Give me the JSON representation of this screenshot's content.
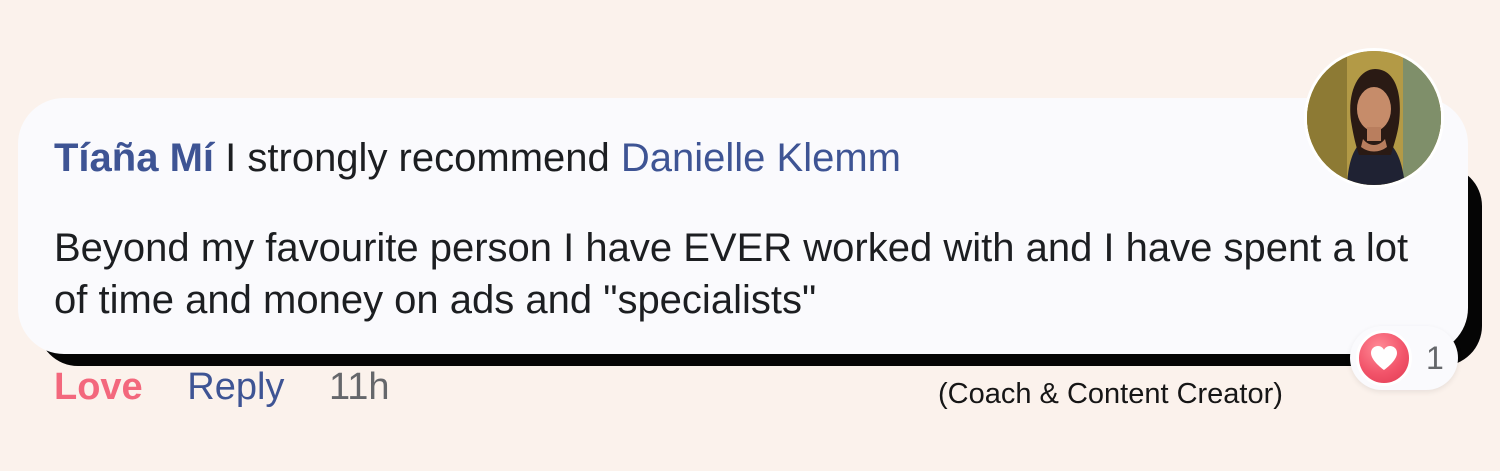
{
  "comment": {
    "author": "Tíaña Mí",
    "intro_text": "I strongly recommend",
    "mention": "Danielle Klemm",
    "body": "Beyond my favourite person I have EVER worked with and I have spent a lot of time and money on ads and \"specialists\""
  },
  "reactions": {
    "icon": "heart-icon",
    "count": "1"
  },
  "actions": {
    "love_label": "Love",
    "reply_label": "Reply",
    "timestamp": "11h"
  },
  "caption": "(Coach & Content Creator)",
  "colors": {
    "background": "#fbf2ec",
    "card": "#fafafd",
    "link_blue": "#3e5494",
    "love_pink": "#f3687d",
    "muted_gray": "#65676b"
  }
}
